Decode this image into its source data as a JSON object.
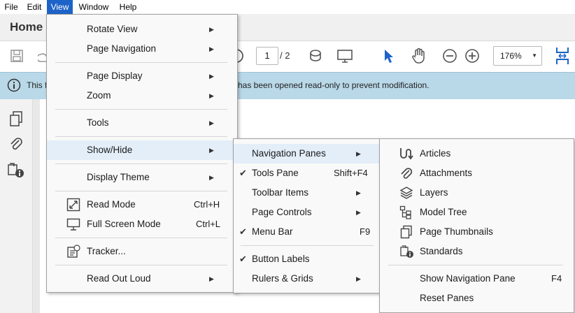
{
  "menubar": {
    "items": [
      {
        "label": "File"
      },
      {
        "label": "Edit"
      },
      {
        "label": "View"
      },
      {
        "label": "Window"
      },
      {
        "label": "Help"
      }
    ]
  },
  "tabs": {
    "home": "Home"
  },
  "toolbar": {
    "page_current": "1",
    "page_total": "/ 2",
    "zoom": "176%"
  },
  "infobar": {
    "text_left": "This f",
    "text_right": "has been opened read-only to prevent modification."
  },
  "view_menu": {
    "items": [
      {
        "label": "Rotate View",
        "submenu": true
      },
      {
        "label": "Page Navigation",
        "submenu": true
      },
      {
        "label": "Page Display",
        "submenu": true
      },
      {
        "label": "Zoom",
        "submenu": true
      },
      {
        "label": "Tools",
        "submenu": true
      },
      {
        "label": "Show/Hide",
        "submenu": true
      },
      {
        "label": "Display Theme",
        "submenu": true
      },
      {
        "label": "Read Mode",
        "shortcut": "Ctrl+H"
      },
      {
        "label": "Full Screen Mode",
        "shortcut": "Ctrl+L"
      },
      {
        "label": "Tracker..."
      },
      {
        "label": "Read Out Loud",
        "submenu": true
      }
    ]
  },
  "showhide_menu": {
    "items": [
      {
        "label": "Navigation Panes",
        "submenu": true
      },
      {
        "label": "Tools Pane",
        "shortcut": "Shift+F4",
        "checked": true
      },
      {
        "label": "Toolbar Items",
        "submenu": true
      },
      {
        "label": "Page Controls",
        "submenu": true
      },
      {
        "label": "Menu Bar",
        "shortcut": "F9",
        "checked": true
      },
      {
        "label": "Button Labels",
        "checked": true
      },
      {
        "label": "Rulers & Grids",
        "submenu": true
      }
    ]
  },
  "navpanes_menu": {
    "items": [
      {
        "label": "Articles",
        "icon": "articles-icon"
      },
      {
        "label": "Attachments",
        "icon": "paperclip-icon"
      },
      {
        "label": "Layers",
        "icon": "layers-icon"
      },
      {
        "label": "Model Tree",
        "icon": "model-tree-icon"
      },
      {
        "label": "Page Thumbnails",
        "icon": "page-thumbnails-icon"
      },
      {
        "label": "Standards",
        "icon": "standards-icon"
      },
      {
        "label": "Show Navigation Pane",
        "shortcut": "F4"
      },
      {
        "label": "Reset Panes"
      }
    ]
  },
  "colors": {
    "menu_active": "#1e63c8",
    "menu_highlight": "#e3eef9",
    "infobar_bg": "#b9d8e8",
    "toolbar_accent": "#1e63c8"
  }
}
